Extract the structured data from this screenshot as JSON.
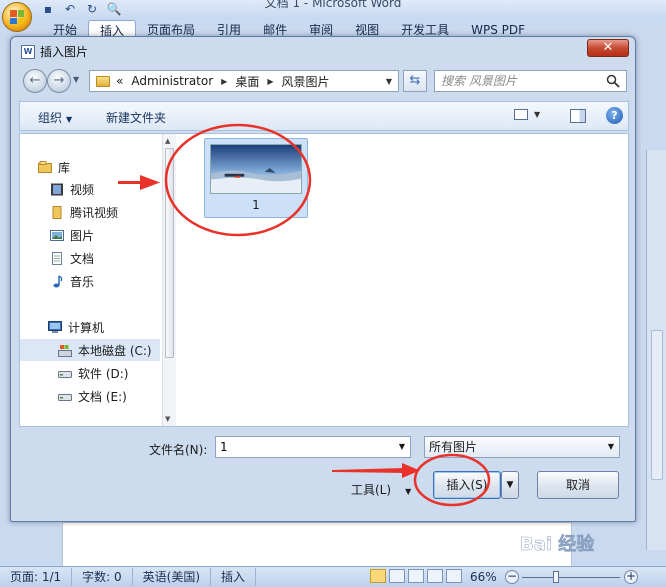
{
  "word": {
    "title": "文档 1 - Microsoft Word",
    "ribbon_tabs": [
      "开始",
      "插入",
      "页面布局",
      "引用",
      "邮件",
      "审阅",
      "视图",
      "开发工具",
      "WPS PDF"
    ],
    "active_tab_index": 1
  },
  "dialog": {
    "title": "插入图片",
    "close_label": "✕",
    "address": {
      "prefix": "«",
      "segments": [
        "Administrator",
        "桌面",
        "风景图片"
      ]
    },
    "search_placeholder": "搜索 风景图片",
    "toolbar": {
      "organize": "组织",
      "new_folder": "新建文件夹"
    },
    "nav_pane": {
      "libraries_header": "库",
      "libraries": [
        "视频",
        "腾讯视频",
        "图片",
        "文档",
        "音乐"
      ],
      "computer_header": "计算机",
      "drives": [
        "本地磁盘 (C:)",
        "软件 (D:)",
        "文档 (E:)"
      ],
      "selected_drive_index": 0
    },
    "files": [
      {
        "name": "1",
        "selected": true
      }
    ],
    "filename_label": "文件名(N):",
    "filename_value": "1",
    "filetype_value": "所有图片",
    "tools_label": "工具(L)",
    "insert_label": "插入(S)",
    "cancel_label": "取消"
  },
  "statusbar": {
    "page": "页面: 1/1",
    "words": "字数: 0",
    "language": "英语(美国)",
    "mode": "插入",
    "zoom": "66%"
  },
  "watermark": "Bai 经验",
  "colors": {
    "annotation": "#e8322a",
    "accent": "#2b5797"
  }
}
